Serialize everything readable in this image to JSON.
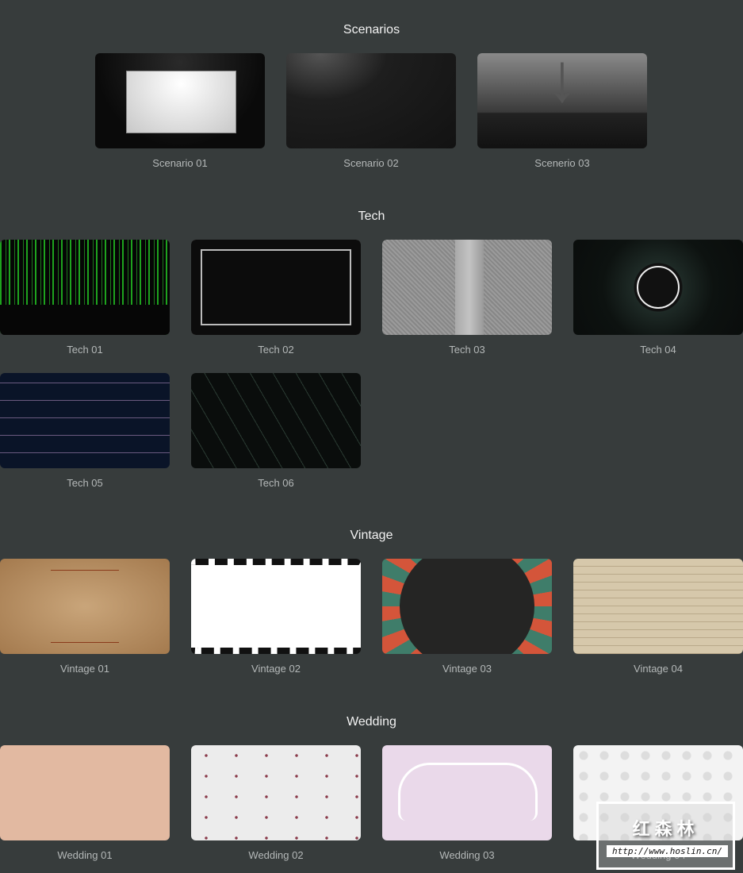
{
  "sections": [
    {
      "title": "Scenarios",
      "items": [
        "Scenario 01",
        "Scenario 02",
        "Scenerio 03"
      ]
    },
    {
      "title": "Tech",
      "items": [
        "Tech 01",
        "Tech 02",
        "Tech 03",
        "Tech 04",
        "Tech 05",
        "Tech 06"
      ]
    },
    {
      "title": "Vintage",
      "items": [
        "Vintage 01",
        "Vintage 02",
        "Vintage 03",
        "Vintage 04"
      ]
    },
    {
      "title": "Wedding",
      "items": [
        "Wedding 01",
        "Wedding 02",
        "Wedding 03",
        "Wedding 04"
      ]
    }
  ],
  "watermark": {
    "text": "红森林",
    "url": "http://www.hoslin.cn/"
  }
}
